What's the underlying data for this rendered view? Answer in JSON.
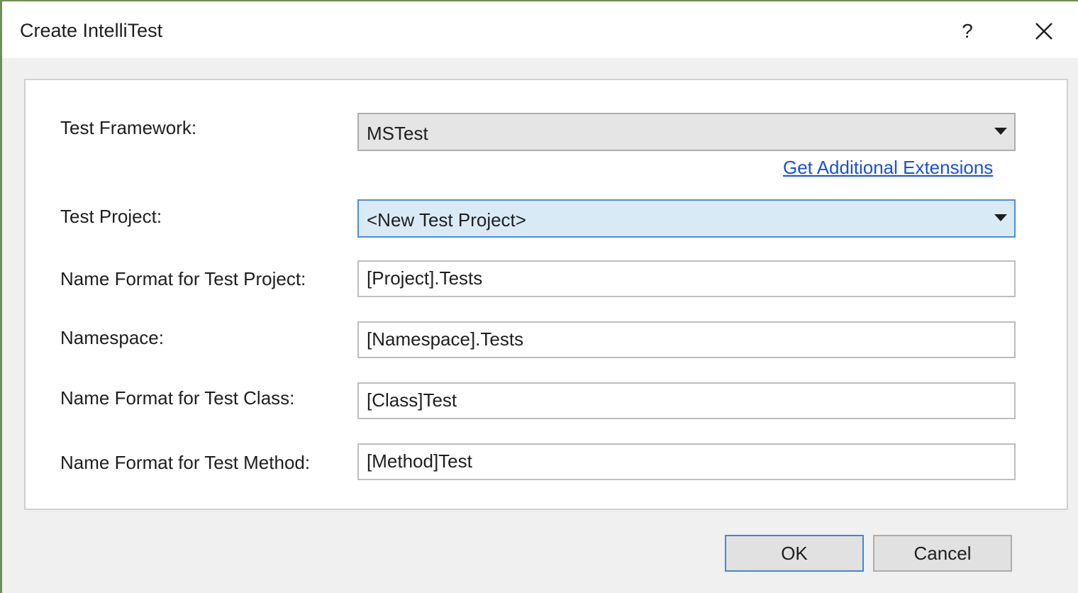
{
  "window": {
    "title": "Create IntelliTest",
    "help_glyph": "?",
    "close_icon": "close-icon"
  },
  "form": {
    "test_framework": {
      "label": "Test Framework:",
      "value": "MSTest"
    },
    "extensions_link": "Get Additional Extensions",
    "test_project": {
      "label": "Test Project:",
      "value": "<New Test Project>"
    },
    "project_name_format": {
      "label": "Name Format for Test Project:",
      "value": "[Project].Tests"
    },
    "namespace": {
      "label": "Namespace:",
      "value": "[Namespace].Tests"
    },
    "class_name_format": {
      "label": "Name Format for Test Class:",
      "value": "[Class]Test"
    },
    "method_name_format": {
      "label": "Name Format for Test Method:",
      "value": "[Method]Test"
    }
  },
  "buttons": {
    "ok": "OK",
    "cancel": "Cancel"
  },
  "colors": {
    "link": "#1a4fd6",
    "focus_border": "#4a90d0",
    "focus_fill": "#d9eaf7",
    "window_border": "#6f8f56"
  }
}
